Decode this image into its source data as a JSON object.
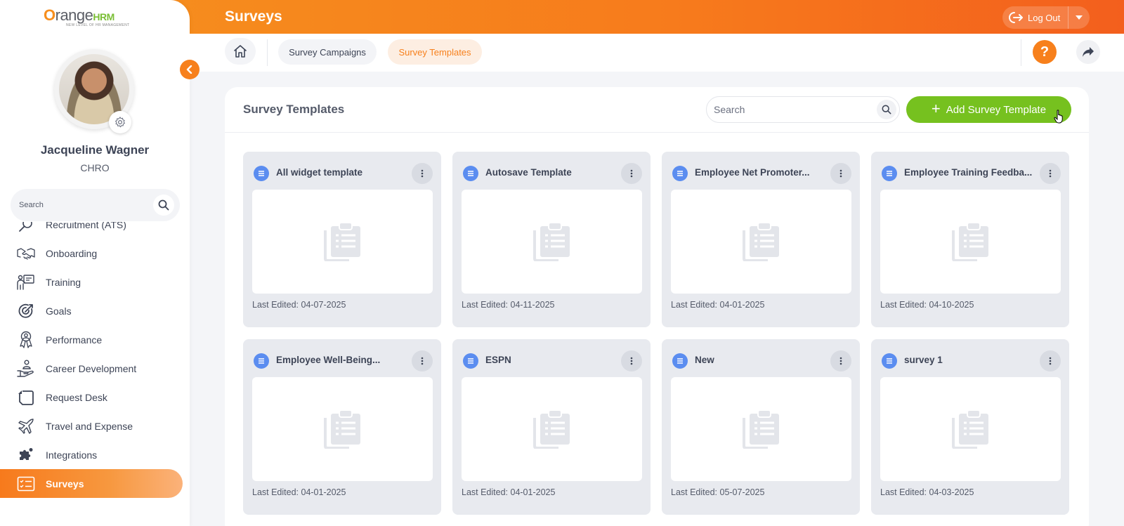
{
  "header": {
    "title": "Surveys",
    "logout_label": "Log Out"
  },
  "brand": {
    "logo_text_o": "O",
    "logo_text_range": "range",
    "logo_text_hrm": "HRM",
    "logo_tagline": "NEW LEVEL OF HR MANAGEMENT"
  },
  "user": {
    "name": "Jacqueline Wagner",
    "role": "CHRO"
  },
  "sidebar": {
    "search_placeholder": "Search",
    "items": [
      {
        "label": "Recruitment (ATS)",
        "icon": "recruitment-icon"
      },
      {
        "label": "Onboarding",
        "icon": "handshake-icon"
      },
      {
        "label": "Training",
        "icon": "training-icon"
      },
      {
        "label": "Goals",
        "icon": "goals-icon"
      },
      {
        "label": "Performance",
        "icon": "performance-icon"
      },
      {
        "label": "Career Development",
        "icon": "career-icon"
      },
      {
        "label": "Request Desk",
        "icon": "request-desk-icon"
      },
      {
        "label": "Travel and Expense",
        "icon": "plane-icon"
      },
      {
        "label": "Integrations",
        "icon": "puzzle-icon"
      },
      {
        "label": "Surveys",
        "icon": "surveys-icon",
        "active": true
      }
    ]
  },
  "subnav": {
    "tabs": [
      {
        "label": "Survey Campaigns"
      },
      {
        "label": "Survey Templates",
        "active": true
      }
    ],
    "help_label": "?"
  },
  "main": {
    "title": "Survey Templates",
    "search_placeholder": "Search",
    "add_button_label": "Add Survey Template",
    "templates": [
      {
        "title": "All widget template",
        "date": "Last Edited: 04-07-2025"
      },
      {
        "title": "Autosave Template",
        "date": "Last Edited: 04-11-2025"
      },
      {
        "title": "Employee Net Promoter...",
        "date": "Last Edited: 04-01-2025"
      },
      {
        "title": "Employee Training Feedba...",
        "date": "Last Edited: 04-10-2025"
      },
      {
        "title": "Employee Well-Being...",
        "date": "Last Edited: 04-01-2025"
      },
      {
        "title": "ESPN",
        "date": "Last Edited: 04-01-2025"
      },
      {
        "title": "New",
        "date": "Last Edited: 05-07-2025"
      },
      {
        "title": "survey 1",
        "date": "Last Edited: 04-03-2025"
      }
    ]
  },
  "colors": {
    "accent": "#f7801c",
    "green": "#76c11f",
    "template_icon": "#5b8df0"
  }
}
